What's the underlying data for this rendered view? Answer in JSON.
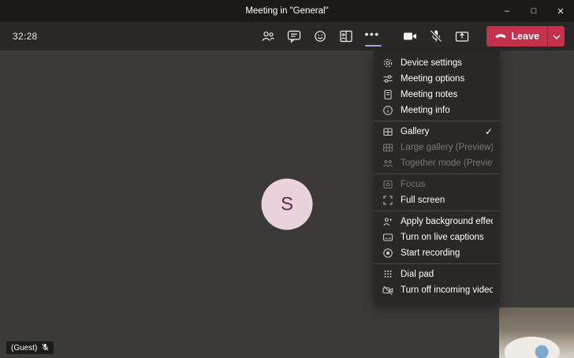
{
  "window": {
    "title": "Meeting in \"General\""
  },
  "icons": {
    "minimize": "–",
    "maximize": "□",
    "close": "✕",
    "check": "✓",
    "more": "•••"
  },
  "toolbar": {
    "timer": "32:28",
    "leave_label": "Leave",
    "nav_icons": [
      "participants",
      "chat",
      "reactions",
      "breakout-rooms",
      "more-actions"
    ],
    "av_icons": [
      "camera",
      "microphone-muted",
      "share-content"
    ]
  },
  "stage": {
    "avatar_letter": "S",
    "guest_label": "(Guest)"
  },
  "menu": {
    "groups": [
      {
        "items": [
          {
            "label": "Device settings",
            "icon": "gear",
            "disabled": false
          },
          {
            "label": "Meeting options",
            "icon": "sliders",
            "disabled": false
          },
          {
            "label": "Meeting notes",
            "icon": "notes",
            "disabled": false
          },
          {
            "label": "Meeting info",
            "icon": "info",
            "disabled": false
          }
        ]
      },
      {
        "items": [
          {
            "label": "Gallery",
            "icon": "gallery-grid",
            "disabled": false,
            "checked": true
          },
          {
            "label": "Large gallery (Preview)",
            "icon": "large-gallery-grid",
            "disabled": true
          },
          {
            "label": "Together mode (Preview)",
            "icon": "together-mode",
            "disabled": true
          }
        ]
      },
      {
        "items": [
          {
            "label": "Focus",
            "icon": "focus",
            "disabled": true
          },
          {
            "label": "Full screen",
            "icon": "fullscreen",
            "disabled": false
          }
        ]
      },
      {
        "items": [
          {
            "label": "Apply background effects",
            "icon": "background-effects",
            "disabled": false
          },
          {
            "label": "Turn on live captions",
            "icon": "captions",
            "disabled": false
          },
          {
            "label": "Start recording",
            "icon": "record",
            "disabled": false
          }
        ]
      },
      {
        "items": [
          {
            "label": "Dial pad",
            "icon": "dialpad",
            "disabled": false
          },
          {
            "label": "Turn off incoming video",
            "icon": "video-off",
            "disabled": false
          }
        ]
      }
    ]
  },
  "colors": {
    "leave_red": "#c4314b",
    "accent_underline": "#a6a7dc",
    "avatar_bg": "#e9d2dc",
    "avatar_text": "#5c2e4d",
    "menu_bg": "#292827"
  }
}
